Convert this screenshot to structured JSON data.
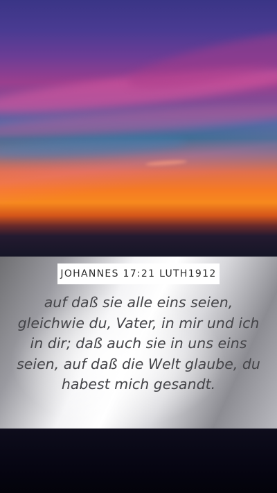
{
  "reference": "JOHANNES 17:21 LUTH1912",
  "verse": "auf daß sie alle eins seien, gleichwie du, Vater, in mir und ich in dir; daß auch sie in uns eins seien, auf daß die Welt glaube, du habest mich gesandt."
}
